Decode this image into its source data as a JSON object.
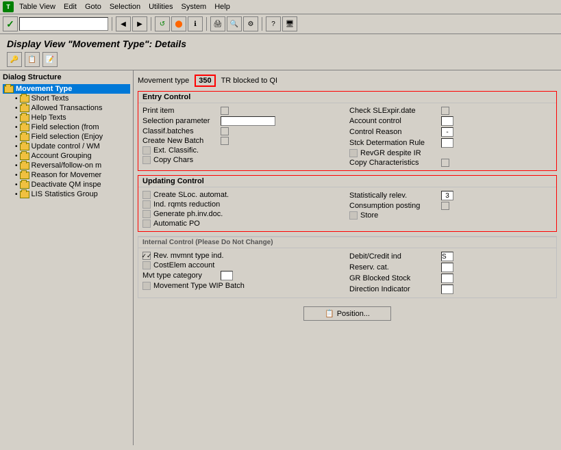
{
  "menubar": {
    "icon": "T",
    "items": [
      "Table View",
      "Edit",
      "Goto",
      "Selection",
      "Utilities",
      "System",
      "Help"
    ]
  },
  "toolbar": {
    "checkmark": "✓",
    "nav_input_placeholder": ""
  },
  "page": {
    "title": "Display View \"Movement Type\": Details",
    "movement_type_label": "Movement type",
    "movement_type_value": "350",
    "movement_type_desc": "TR blocked to QI"
  },
  "dialog_structure": {
    "title": "Dialog Structure",
    "root_item": "Movement Type",
    "children": [
      "Short Texts",
      "Allowed Transactions",
      "Help Texts",
      "Field selection (from",
      "Field selection (Enjoy",
      "Update control / WM",
      "Account Grouping",
      "Reversal/follow-on m",
      "Reason for Movemer",
      "Deactivate QM inspe",
      "LIS Statistics Group"
    ]
  },
  "entry_control": {
    "title": "Entry Control",
    "left_fields": [
      {
        "label": "Print item",
        "type": "checkbox",
        "checked": false
      },
      {
        "label": "Selection parameter",
        "type": "input_medium",
        "value": ""
      },
      {
        "label": "Classif.batches",
        "type": "checkbox",
        "checked": false
      },
      {
        "label": "Create New Batch",
        "type": "checkbox",
        "checked": false
      },
      {
        "label": "Ext. Classific.",
        "type": "disabled_checkbox",
        "checked": false
      },
      {
        "label": "Copy Chars",
        "type": "disabled_checkbox",
        "checked": false
      }
    ],
    "right_fields": [
      {
        "label": "Check SLExpir.date",
        "type": "checkbox",
        "checked": false
      },
      {
        "label": "Account control",
        "type": "input_dash",
        "value": ""
      },
      {
        "label": "Control Reason",
        "type": "input_dash",
        "value": "-"
      },
      {
        "label": "Stck Determation Rule",
        "type": "input_small",
        "value": ""
      },
      {
        "label": "RevGR despite IR",
        "type": "disabled_checkbox",
        "checked": false
      },
      {
        "label": "Copy Characteristics",
        "type": "checkbox",
        "checked": false
      }
    ]
  },
  "updating_control": {
    "title": "Updating Control",
    "left_fields": [
      {
        "label": "Create SLoc. automat.",
        "type": "disabled_checkbox",
        "checked": false
      },
      {
        "label": "Ind. rqmts reduction",
        "type": "disabled_checkbox",
        "checked": false
      },
      {
        "label": "Generate ph.inv.doc.",
        "type": "disabled_checkbox",
        "checked": false
      },
      {
        "label": "Automatic PO",
        "type": "disabled_checkbox",
        "checked": false
      }
    ],
    "right_fields": [
      {
        "label": "Statistically relev.",
        "type": "input_num",
        "value": "3"
      },
      {
        "label": "Consumption posting",
        "type": "checkbox",
        "checked": false
      },
      {
        "label": "Store",
        "type": "disabled_checkbox",
        "checked": false
      }
    ]
  },
  "internal_control": {
    "title": "Internal Control (Please Do Not Change)",
    "left_fields": [
      {
        "label": "Rev. mvmnt type ind.",
        "type": "checkbox_checked",
        "checked": true
      },
      {
        "label": "CostElem account",
        "type": "disabled_checkbox",
        "checked": false
      },
      {
        "label": "Mvt type category",
        "type": "input_small",
        "value": ""
      },
      {
        "label": "Movement Type WIP Batch",
        "type": "disabled_checkbox",
        "checked": false
      }
    ],
    "right_fields": [
      {
        "label": "Debit/Credit ind",
        "type": "input_small",
        "value": "S"
      },
      {
        "label": "Reserv. cat.",
        "type": "input_small",
        "value": ""
      },
      {
        "label": "GR Blocked Stock",
        "type": "input_small",
        "value": ""
      },
      {
        "label": "Direction Indicator",
        "type": "input_small",
        "value": ""
      }
    ]
  },
  "position_button": "Position..."
}
